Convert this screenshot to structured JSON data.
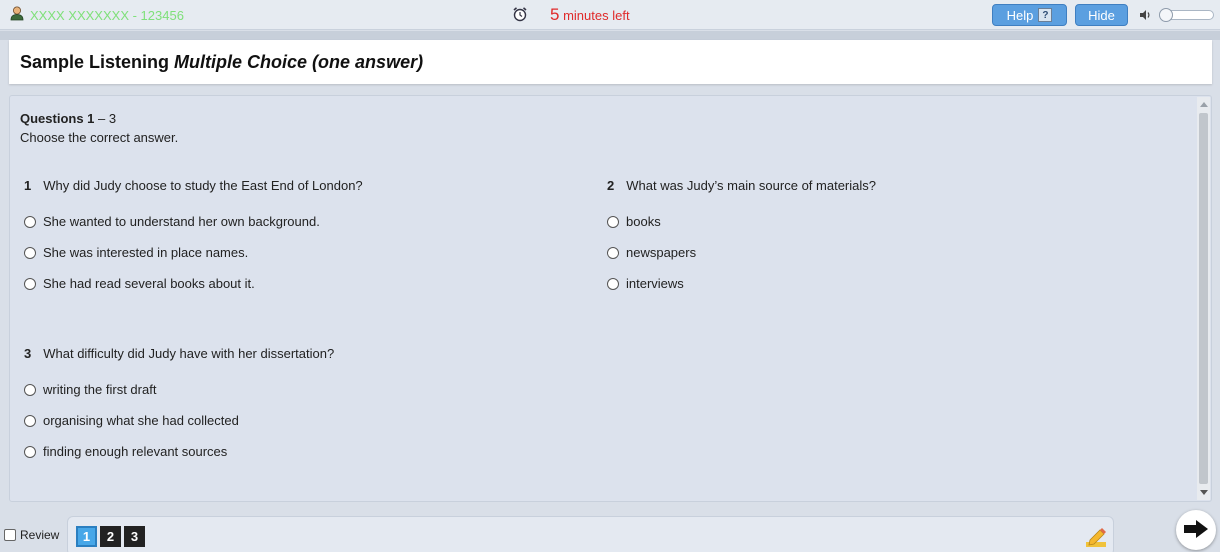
{
  "topbar": {
    "candidate": "XXXX XXXXXXX - 123456",
    "timer_number": "5",
    "timer_suffix": "minutes left",
    "help_label": "Help",
    "help_icon_glyph": "?",
    "hide_label": "Hide"
  },
  "title": {
    "prefix": "Sample Listening",
    "italic": "Multiple Choice (one answer)"
  },
  "instructions": {
    "heading": "Questions 1",
    "heading_dash": " – 3",
    "text": "Choose the correct answer."
  },
  "questions": [
    {
      "number": "1",
      "text": "Why did Judy choose to study the East End of London?",
      "options": [
        "She wanted to understand her own background.",
        "She was interested in place names.",
        "She had read several books about it."
      ]
    },
    {
      "number": "2",
      "text": "What was Judy’s main source of materials?",
      "options": [
        "books",
        "newspapers",
        "interviews"
      ]
    },
    {
      "number": "3",
      "text": "What difficulty did Judy have with her dissertation?",
      "options": [
        "writing the first draft",
        "organising what she had collected",
        "finding enough relevant sources"
      ]
    }
  ],
  "footer": {
    "review_label": "Review",
    "nav_items": [
      "1",
      "2",
      "3"
    ],
    "active_item": "1"
  },
  "icons": {
    "candidate": "person-icon",
    "timer": "alarm-clock-icon",
    "volume": "speaker-icon",
    "pencil": "pencil-icon",
    "next": "arrow-right-icon"
  },
  "colors": {
    "accent": "#5b9fe0",
    "timer": "#e02a2a",
    "candidate": "#7fe07a",
    "active_nav": "#47a7e8"
  }
}
